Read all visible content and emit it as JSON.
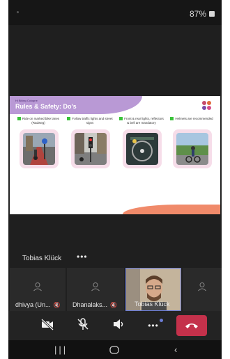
{
  "status_bar": {
    "battery": "87%"
  },
  "slide": {
    "tag": "Hi Biking Cologne",
    "title": "Rules & Safety: Do's",
    "rules": [
      {
        "text": "Ride on marked bike lanes (Radweg)"
      },
      {
        "text": "Follow traffic lights and street signs"
      },
      {
        "text": "Front & rear lights, reflectors & bell are mandatory"
      },
      {
        "text": "Helmets are recommended"
      }
    ]
  },
  "presenter": {
    "name": "Tobias Klück",
    "more_label": "•••"
  },
  "participants": [
    {
      "name": "dhivya (Un...",
      "muted": true
    },
    {
      "name": "Dhanalaks...",
      "muted": true
    },
    {
      "name": "Tobias Klück",
      "muted": false
    }
  ],
  "controls": {
    "more_label": "•••"
  },
  "colors": {
    "hangup": "#c4314b",
    "active_border": "#6c7dd6"
  }
}
